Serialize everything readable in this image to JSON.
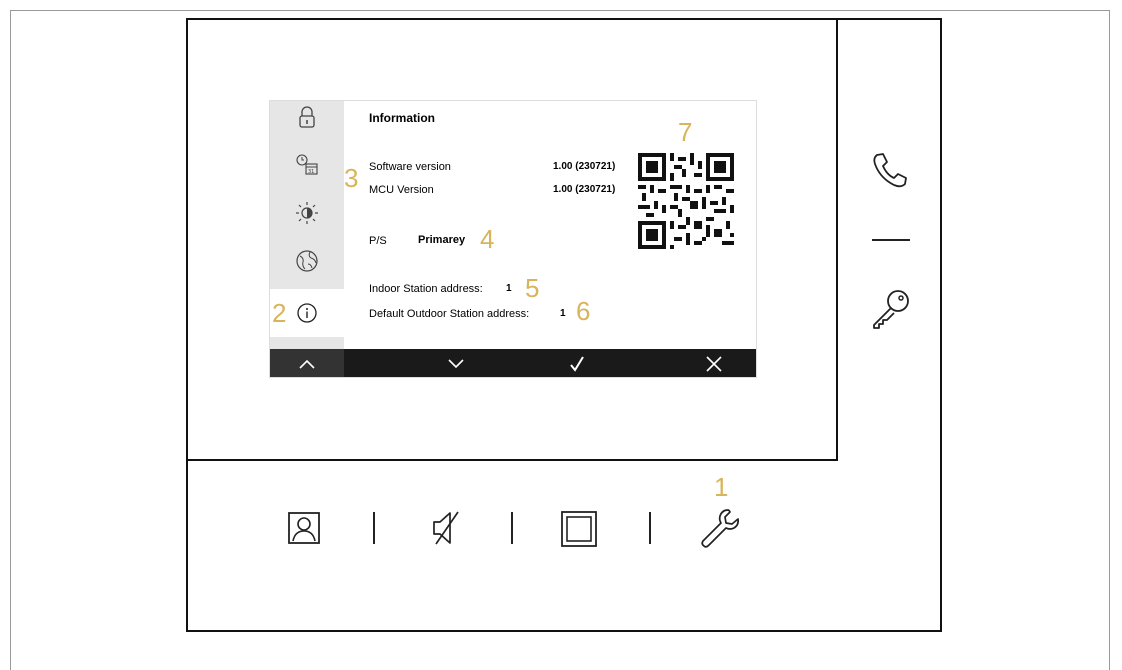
{
  "screen": {
    "title": "Information",
    "software_label": "Software version",
    "software_value": "1.00 (230721)",
    "mcu_label": "MCU Version",
    "mcu_value": "1.00 (230721)",
    "ps_label": "P/S",
    "ps_value": "Primarey",
    "indoor_label": "Indoor Station address:",
    "indoor_value": "1",
    "outdoor_label": "Default Outdoor Station address:",
    "outdoor_value": "1"
  },
  "sidebar": {
    "items": [
      {
        "icon": "unlock-icon"
      },
      {
        "icon": "clock-calendar-icon",
        "day": "31"
      },
      {
        "icon": "brightness-icon"
      },
      {
        "icon": "globe-icon"
      },
      {
        "icon": "info-icon",
        "active": true
      }
    ]
  },
  "bottom_bar": {
    "buttons": [
      {
        "icon": "chevron-up-icon"
      },
      {
        "icon": "chevron-down-icon"
      },
      {
        "icon": "check-icon"
      },
      {
        "icon": "close-icon"
      }
    ]
  },
  "hardware": {
    "right_buttons": [
      {
        "icon": "phone-icon"
      },
      {
        "icon": "key-icon"
      }
    ],
    "bottom_buttons": [
      {
        "icon": "user-monitor-icon"
      },
      {
        "icon": "mute-icon"
      },
      {
        "icon": "square-icon"
      },
      {
        "icon": "wrench-icon"
      }
    ]
  },
  "callouts": {
    "c1": "1",
    "c2": "2",
    "c3": "3",
    "c4": "4",
    "c5": "5",
    "c6": "6",
    "c7": "7"
  },
  "colors": {
    "callout": "#d8b45a",
    "bar": "#1a1a1a",
    "sidebar": "#e6e6e6"
  }
}
